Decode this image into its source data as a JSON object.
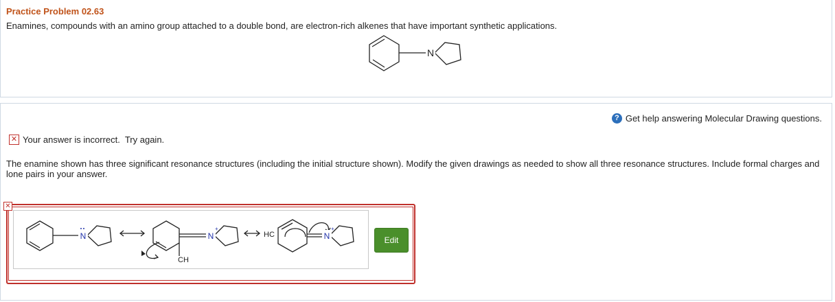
{
  "problem": {
    "title": "Practice Problem 02.63",
    "description": "Enamines, compounds with an amino group attached to a double bond, are electron-rich alkenes that have important synthetic applications."
  },
  "structure_labels": {
    "nitrogen": "N",
    "hc": "HC",
    "ch": "CH"
  },
  "help": {
    "icon": "question-circle-icon",
    "label": "Get help answering Molecular Drawing questions."
  },
  "status": {
    "icon": "incorrect-x-icon",
    "text": "Your answer is incorrect.  Try again."
  },
  "instructions": "The enamine shown has three significant resonance structures (including the initial structure shown). Modify the given drawings as needed to show all three resonance structures. Include formal charges and lone pairs in your answer.",
  "answer": {
    "status_icon": "incorrect-x-icon",
    "edit_label": "Edit"
  },
  "colors": {
    "title": "#c0531a",
    "incorrect": "#c0302b",
    "edit_button": "#4a8f2b",
    "help_icon": "#2c6fbb",
    "nitrogen": "#2233aa"
  }
}
